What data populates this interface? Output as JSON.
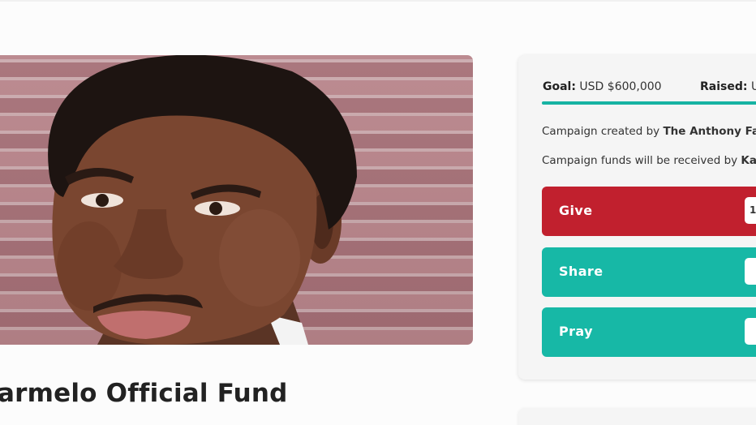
{
  "campaign": {
    "title": "armelo Official Fund",
    "goal_label": "Goal:",
    "goal_value": "USD $600,000",
    "raised_label": "Raised:",
    "raised_value": "US",
    "progress_fraction": 1.0,
    "created_prefix": "Campaign created by",
    "created_by": "The Anthony Famil",
    "funds_prefix": "Campaign funds will be received by",
    "funds_recipient": "Kala"
  },
  "actions": {
    "give_label": "Give",
    "give_count": "1",
    "share_label": "Share",
    "share_count": "",
    "pray_label": "Pray",
    "pray_count": ""
  },
  "colors": {
    "give": "#c1202e",
    "share": "#17b8a6",
    "pray": "#17b8a6",
    "progress": "#17b3a3"
  }
}
